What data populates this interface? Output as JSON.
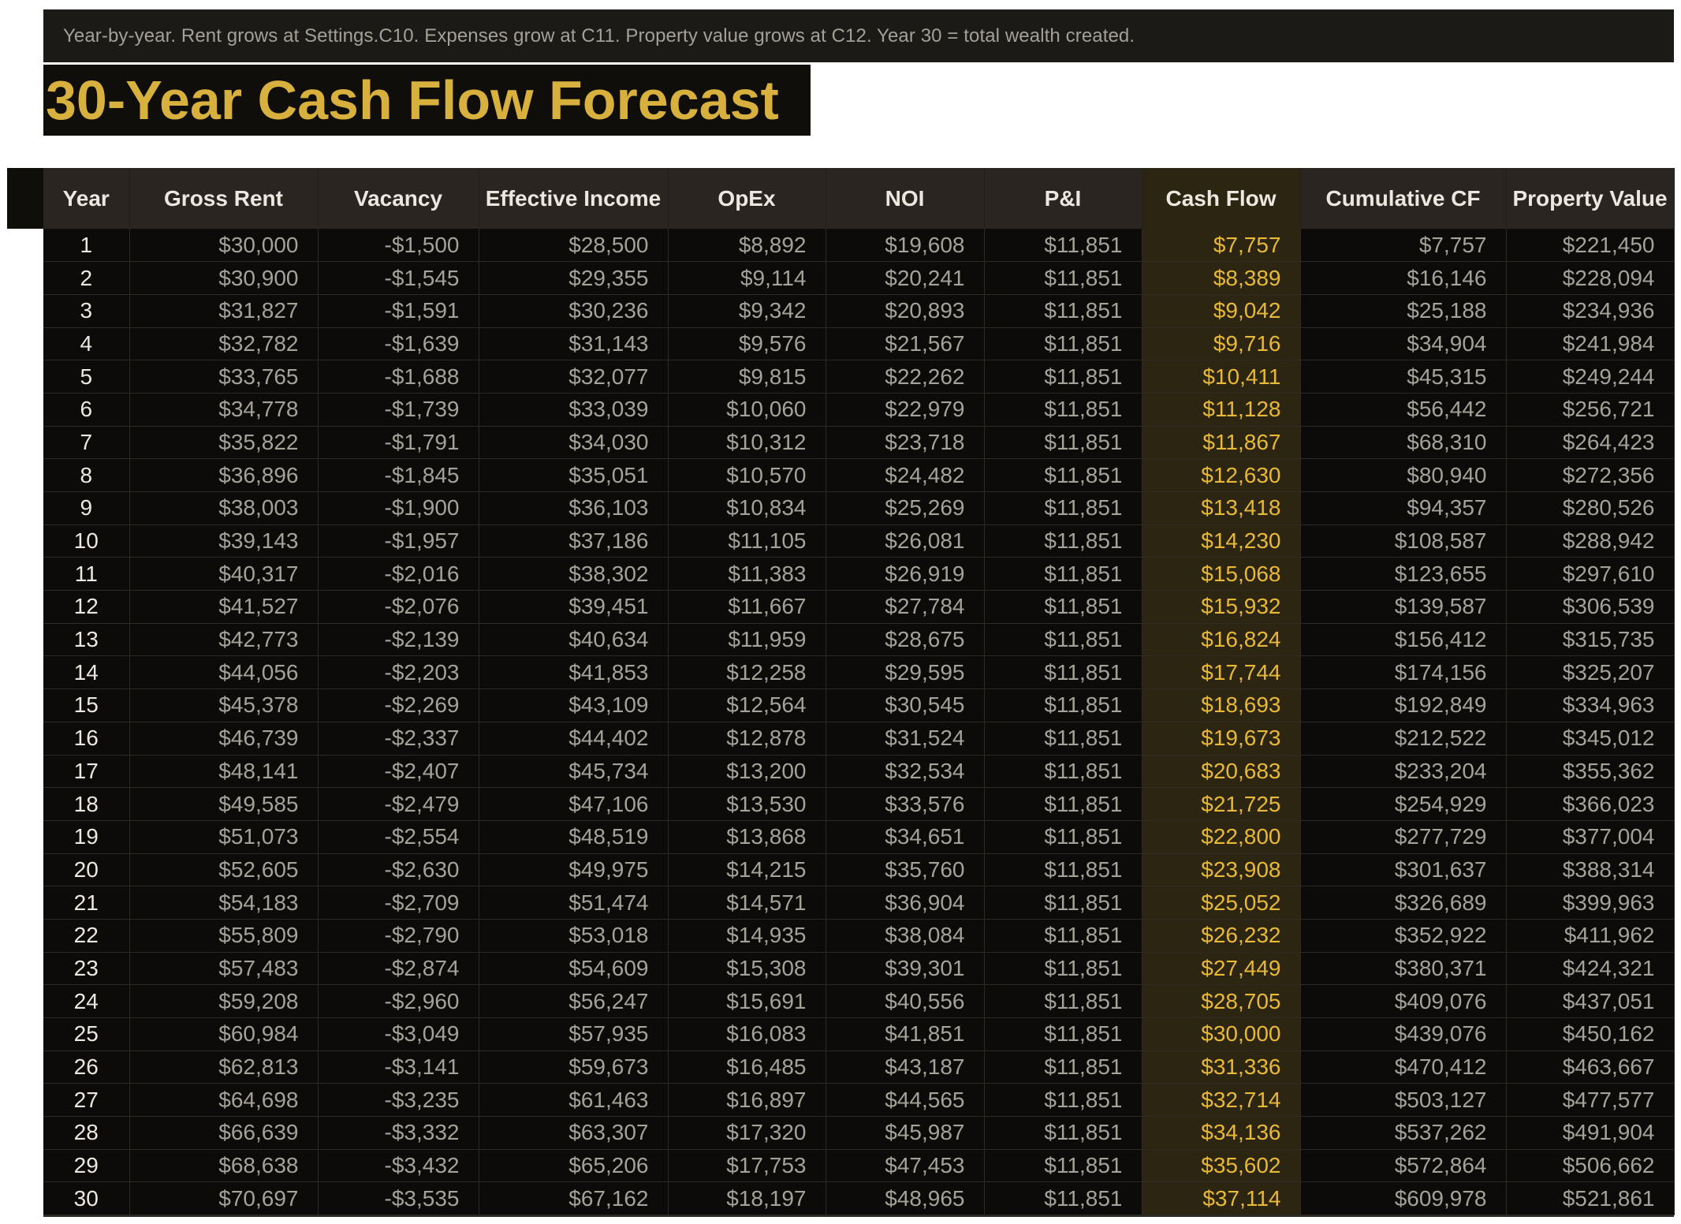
{
  "note": "Year-by-year. Rent grows at Settings.C10. Expenses grow at C11. Property value grows at C12. Year 30 = total wealth created.",
  "title": "30-Year Cash Flow Forecast",
  "colors": {
    "accent_gold": "#d8b03e",
    "cash_flow_text": "#e8b936",
    "cash_flow_bg": "#2c2512",
    "header_bg": "#2a2520",
    "sheet_bg": "#0c0b09"
  },
  "columns": [
    "Year",
    "Gross Rent",
    "Vacancy",
    "Effective Income",
    "OpEx",
    "NOI",
    "P&I",
    "Cash Flow",
    "Cumulative CF",
    "Property Value"
  ],
  "rows": [
    [
      "1",
      "$30,000",
      "-$1,500",
      "$28,500",
      "$8,892",
      "$19,608",
      "$11,851",
      "$7,757",
      "$7,757",
      "$221,450"
    ],
    [
      "2",
      "$30,900",
      "-$1,545",
      "$29,355",
      "$9,114",
      "$20,241",
      "$11,851",
      "$8,389",
      "$16,146",
      "$228,094"
    ],
    [
      "3",
      "$31,827",
      "-$1,591",
      "$30,236",
      "$9,342",
      "$20,893",
      "$11,851",
      "$9,042",
      "$25,188",
      "$234,936"
    ],
    [
      "4",
      "$32,782",
      "-$1,639",
      "$31,143",
      "$9,576",
      "$21,567",
      "$11,851",
      "$9,716",
      "$34,904",
      "$241,984"
    ],
    [
      "5",
      "$33,765",
      "-$1,688",
      "$32,077",
      "$9,815",
      "$22,262",
      "$11,851",
      "$10,411",
      "$45,315",
      "$249,244"
    ],
    [
      "6",
      "$34,778",
      "-$1,739",
      "$33,039",
      "$10,060",
      "$22,979",
      "$11,851",
      "$11,128",
      "$56,442",
      "$256,721"
    ],
    [
      "7",
      "$35,822",
      "-$1,791",
      "$34,030",
      "$10,312",
      "$23,718",
      "$11,851",
      "$11,867",
      "$68,310",
      "$264,423"
    ],
    [
      "8",
      "$36,896",
      "-$1,845",
      "$35,051",
      "$10,570",
      "$24,482",
      "$11,851",
      "$12,630",
      "$80,940",
      "$272,356"
    ],
    [
      "9",
      "$38,003",
      "-$1,900",
      "$36,103",
      "$10,834",
      "$25,269",
      "$11,851",
      "$13,418",
      "$94,357",
      "$280,526"
    ],
    [
      "10",
      "$39,143",
      "-$1,957",
      "$37,186",
      "$11,105",
      "$26,081",
      "$11,851",
      "$14,230",
      "$108,587",
      "$288,942"
    ],
    [
      "11",
      "$40,317",
      "-$2,016",
      "$38,302",
      "$11,383",
      "$26,919",
      "$11,851",
      "$15,068",
      "$123,655",
      "$297,610"
    ],
    [
      "12",
      "$41,527",
      "-$2,076",
      "$39,451",
      "$11,667",
      "$27,784",
      "$11,851",
      "$15,932",
      "$139,587",
      "$306,539"
    ],
    [
      "13",
      "$42,773",
      "-$2,139",
      "$40,634",
      "$11,959",
      "$28,675",
      "$11,851",
      "$16,824",
      "$156,412",
      "$315,735"
    ],
    [
      "14",
      "$44,056",
      "-$2,203",
      "$41,853",
      "$12,258",
      "$29,595",
      "$11,851",
      "$17,744",
      "$174,156",
      "$325,207"
    ],
    [
      "15",
      "$45,378",
      "-$2,269",
      "$43,109",
      "$12,564",
      "$30,545",
      "$11,851",
      "$18,693",
      "$192,849",
      "$334,963"
    ],
    [
      "16",
      "$46,739",
      "-$2,337",
      "$44,402",
      "$12,878",
      "$31,524",
      "$11,851",
      "$19,673",
      "$212,522",
      "$345,012"
    ],
    [
      "17",
      "$48,141",
      "-$2,407",
      "$45,734",
      "$13,200",
      "$32,534",
      "$11,851",
      "$20,683",
      "$233,204",
      "$355,362"
    ],
    [
      "18",
      "$49,585",
      "-$2,479",
      "$47,106",
      "$13,530",
      "$33,576",
      "$11,851",
      "$21,725",
      "$254,929",
      "$366,023"
    ],
    [
      "19",
      "$51,073",
      "-$2,554",
      "$48,519",
      "$13,868",
      "$34,651",
      "$11,851",
      "$22,800",
      "$277,729",
      "$377,004"
    ],
    [
      "20",
      "$52,605",
      "-$2,630",
      "$49,975",
      "$14,215",
      "$35,760",
      "$11,851",
      "$23,908",
      "$301,637",
      "$388,314"
    ],
    [
      "21",
      "$54,183",
      "-$2,709",
      "$51,474",
      "$14,571",
      "$36,904",
      "$11,851",
      "$25,052",
      "$326,689",
      "$399,963"
    ],
    [
      "22",
      "$55,809",
      "-$2,790",
      "$53,018",
      "$14,935",
      "$38,084",
      "$11,851",
      "$26,232",
      "$352,922",
      "$411,962"
    ],
    [
      "23",
      "$57,483",
      "-$2,874",
      "$54,609",
      "$15,308",
      "$39,301",
      "$11,851",
      "$27,449",
      "$380,371",
      "$424,321"
    ],
    [
      "24",
      "$59,208",
      "-$2,960",
      "$56,247",
      "$15,691",
      "$40,556",
      "$11,851",
      "$28,705",
      "$409,076",
      "$437,051"
    ],
    [
      "25",
      "$60,984",
      "-$3,049",
      "$57,935",
      "$16,083",
      "$41,851",
      "$11,851",
      "$30,000",
      "$439,076",
      "$450,162"
    ],
    [
      "26",
      "$62,813",
      "-$3,141",
      "$59,673",
      "$16,485",
      "$43,187",
      "$11,851",
      "$31,336",
      "$470,412",
      "$463,667"
    ],
    [
      "27",
      "$64,698",
      "-$3,235",
      "$61,463",
      "$16,897",
      "$44,565",
      "$11,851",
      "$32,714",
      "$503,127",
      "$477,577"
    ],
    [
      "28",
      "$66,639",
      "-$3,332",
      "$63,307",
      "$17,320",
      "$45,987",
      "$11,851",
      "$34,136",
      "$537,262",
      "$491,904"
    ],
    [
      "29",
      "$68,638",
      "-$3,432",
      "$65,206",
      "$17,753",
      "$47,453",
      "$11,851",
      "$35,602",
      "$572,864",
      "$506,662"
    ],
    [
      "30",
      "$70,697",
      "-$3,535",
      "$67,162",
      "$18,197",
      "$48,965",
      "$11,851",
      "$37,114",
      "$609,978",
      "$521,861"
    ]
  ]
}
